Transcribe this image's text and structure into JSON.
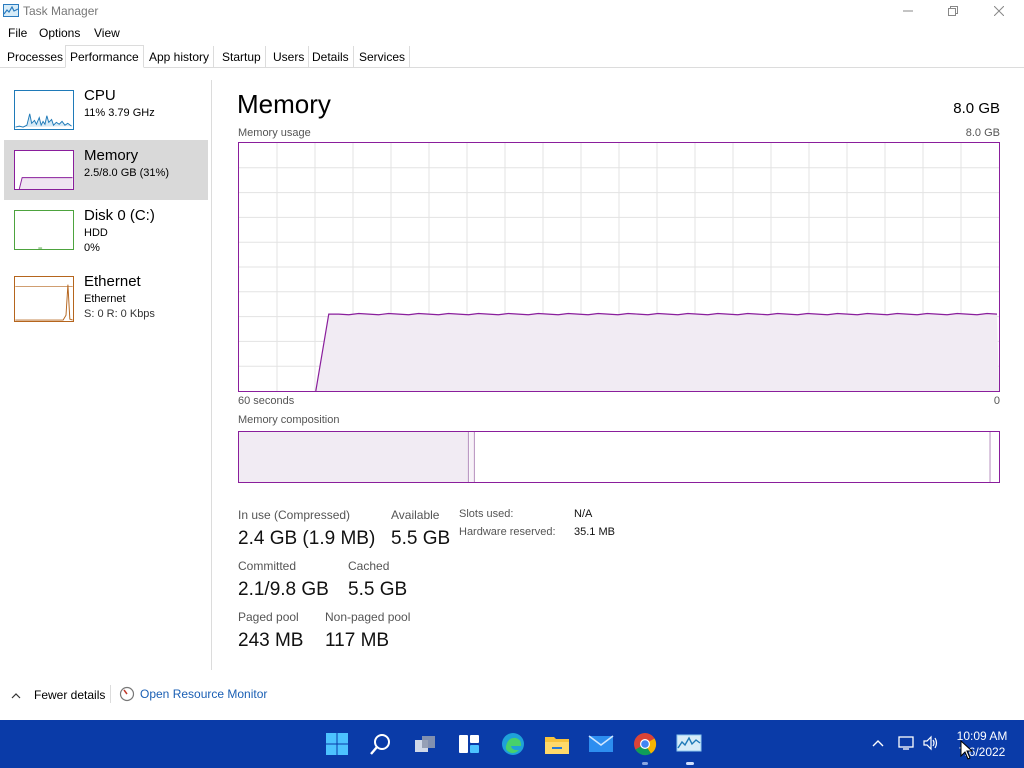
{
  "window": {
    "title": "Task Manager",
    "menu": [
      "File",
      "Options",
      "View"
    ],
    "tabs": [
      "Processes",
      "Performance",
      "App history",
      "Startup",
      "Users",
      "Details",
      "Services"
    ],
    "active_tab": "Performance"
  },
  "sidebar": {
    "items": [
      {
        "name": "CPU",
        "line1": "11% 3.79 GHz",
        "line2": ""
      },
      {
        "name": "Memory",
        "line1": "2.5/8.0 GB (31%)",
        "line2": ""
      },
      {
        "name": "Disk 0 (C:)",
        "line1": "HDD",
        "line2": "0%"
      },
      {
        "name": "Ethernet",
        "line1": "Ethernet",
        "line2": "S: 0 R: 0 Kbps"
      }
    ],
    "selected": "Memory"
  },
  "main": {
    "title": "Memory",
    "total": "8.0 GB",
    "usage_label": "Memory usage",
    "usage_max": "8.0 GB",
    "time_left": "60 seconds",
    "time_right": "0",
    "composition_label": "Memory composition",
    "usage_fraction": 0.31,
    "stats": {
      "in_use_label": "In use (Compressed)",
      "in_use_value": "2.4 GB (1.9 MB)",
      "available_label": "Available",
      "available_value": "5.5 GB",
      "committed_label": "Committed",
      "committed_value": "2.1/9.8 GB",
      "cached_label": "Cached",
      "cached_value": "5.5 GB",
      "paged_label": "Paged pool",
      "paged_value": "243 MB",
      "nonpaged_label": "Non-paged pool",
      "nonpaged_value": "117 MB",
      "slots_label": "Slots used:",
      "slots_value": "N/A",
      "hw_label": "Hardware reserved:",
      "hw_value": "35.1 MB"
    }
  },
  "footer": {
    "fewer_details": "Fewer details",
    "resource_monitor": "Open Resource Monitor"
  },
  "taskbar": {
    "time": "10:09 AM",
    "date": "7/6/2022",
    "icons": [
      "start-icon",
      "search-icon",
      "task-view-icon",
      "widgets-icon",
      "edge-icon",
      "file-explorer-icon",
      "mail-icon",
      "chrome-icon",
      "task-manager-icon"
    ]
  },
  "colors": {
    "memory_accent": "#8a1e9c",
    "cpu_accent": "#1f7ab8",
    "disk_accent": "#4da33e",
    "ethernet_accent": "#b5651d",
    "taskbar": "#0a3ba8"
  }
}
